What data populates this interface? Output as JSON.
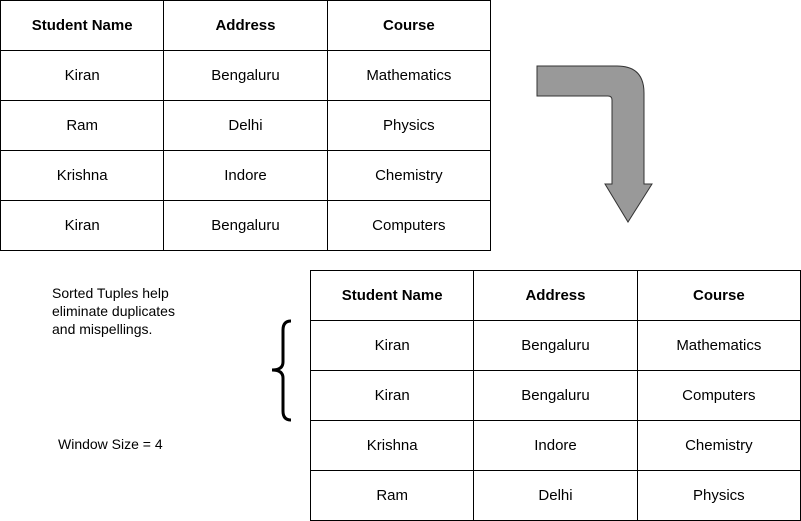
{
  "original_table": {
    "headers": [
      "Student Name",
      "Address",
      "Course"
    ],
    "rows": [
      [
        "Kiran",
        "Bengaluru",
        "Mathematics"
      ],
      [
        "Ram",
        "Delhi",
        "Physics"
      ],
      [
        "Krishna",
        "Indore",
        "Chemistry"
      ],
      [
        "Kiran",
        "Bengaluru",
        "Computers"
      ]
    ]
  },
  "sorted_table": {
    "headers": [
      "Student Name",
      "Address",
      "Course"
    ],
    "rows": [
      [
        "Kiran",
        "Bengaluru",
        "Mathematics"
      ],
      [
        "Kiran",
        "Bengaluru",
        "Computers"
      ],
      [
        "Krishna",
        "Indore",
        "Chemistry"
      ],
      [
        "Ram",
        "Delhi",
        "Physics"
      ]
    ]
  },
  "note": "Sorted Tuples help eliminate duplicates and mispellings.",
  "note_lines": [
    "Sorted Tuples help",
    "eliminate duplicates",
    "and mispellings."
  ],
  "window_size": "Window Size = 4",
  "arrow_color": "#999999"
}
